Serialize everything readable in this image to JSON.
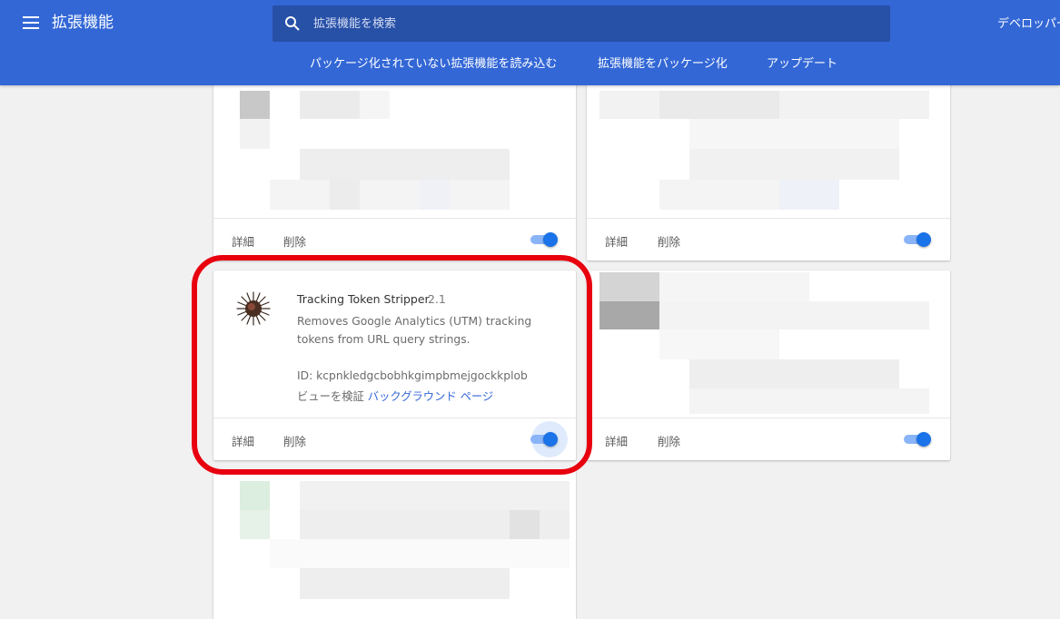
{
  "header": {
    "title": "拡張機能",
    "search_placeholder": "拡張機能を検索",
    "developer_mode_label": "デベロッパー",
    "actions": [
      "パッケージ化されていない拡張機能を読み込む",
      "拡張機能をパッケージ化",
      "アップデート"
    ],
    "color": "#3367d6"
  },
  "cards": {
    "details_label": "詳細",
    "remove_label": "削除"
  },
  "extension": {
    "name": "Tracking Token Stripper",
    "version": "2.1",
    "description": "Removes Google Analytics (UTM) tracking tokens from URL query strings.",
    "id_text": "ID: kcpnkledgcbobhkgimpbmejgockkplob",
    "inspect_label": "ビューを検証",
    "background_page_link": "バックグラウンド ページ",
    "enabled": true,
    "icon": "sea-urchin-icon"
  },
  "annotation": {
    "color": "#e8000e"
  }
}
